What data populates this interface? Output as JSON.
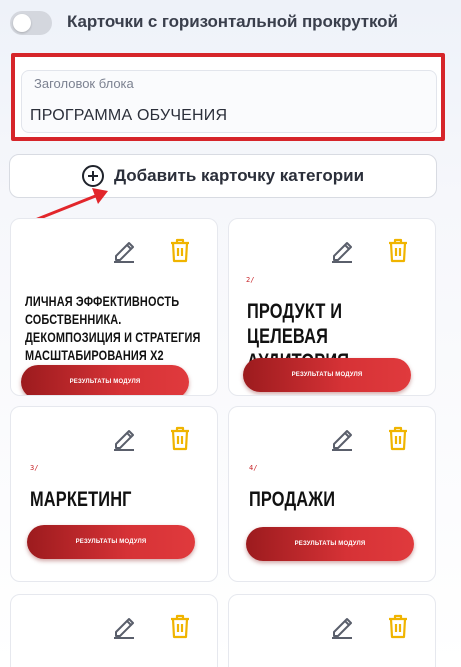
{
  "toggle": {
    "label": "Карточки с горизонтальной прокруткой",
    "enabled": false
  },
  "title_field": {
    "label": "Заголовок блока",
    "value": "ПРОГРАММА ОБУЧЕНИЯ"
  },
  "add_button": {
    "label": "Добавить карточку категории"
  },
  "cards": [
    {
      "title": "Личная эффективность собственника. Декомпозиция и стратегия масштабирования х2",
      "button": "Результаты модуля",
      "tiny": ""
    },
    {
      "title": "Продукт и целевая аудитория",
      "button": "Результаты модуля",
      "tiny": "2/"
    },
    {
      "title": "Маркетинг",
      "button": "Результаты модуля",
      "tiny": "3/"
    },
    {
      "title": "Продажи",
      "button": "Результаты модуля",
      "tiny": "4/"
    }
  ],
  "colors": {
    "accent_red": "#d6252a",
    "trash_yellow": "#f0b400",
    "edit_gray": "#5a5f6b"
  },
  "icons": {
    "edit": "pencil-icon",
    "delete": "trash-icon",
    "add": "plus-circle-icon"
  }
}
